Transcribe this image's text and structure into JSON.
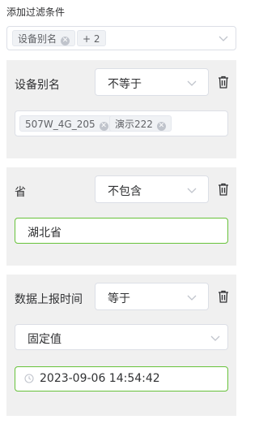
{
  "header": {
    "title": "添加过滤条件"
  },
  "summary": {
    "tag": "设备别名",
    "more": "+ 2"
  },
  "filters": [
    {
      "field": "设备别名",
      "operator": "不等于",
      "values": [
        "507W_4G_205",
        "演示222"
      ]
    },
    {
      "field": "省",
      "operator": "不包含",
      "value": "湖北省"
    },
    {
      "field": "数据上报时间",
      "operator": "等于",
      "value_type": "固定值",
      "datetime": "2023-09-06 14:54:42"
    }
  ],
  "icons": {
    "chevron": "chevron-down-icon",
    "trash": "trash-icon",
    "clock": "clock-icon",
    "close": "close-circle-icon"
  },
  "colors": {
    "active_border": "#67c23a",
    "panel_bg": "#f0f0f0",
    "border": "#dcdfe6"
  }
}
